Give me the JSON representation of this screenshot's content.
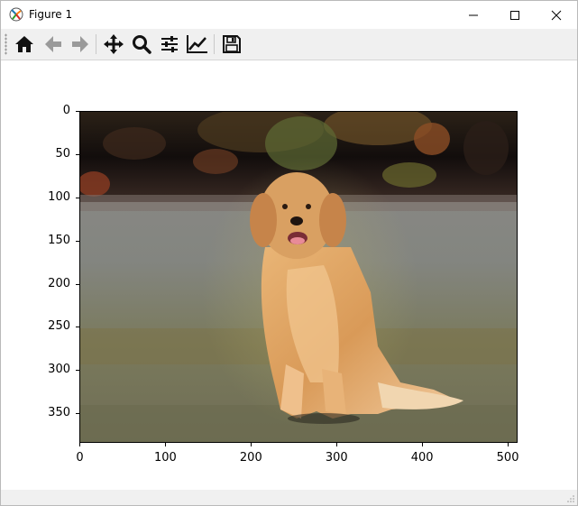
{
  "window": {
    "title": "Figure 1"
  },
  "toolbar": {
    "tools": [
      {
        "name": "home-icon",
        "tooltip": "Home"
      },
      {
        "name": "back-icon",
        "tooltip": "Back"
      },
      {
        "name": "forward-icon",
        "tooltip": "Forward"
      },
      {
        "name": "pan-icon",
        "tooltip": "Pan"
      },
      {
        "name": "zoom-icon",
        "tooltip": "Zoom"
      },
      {
        "name": "subplots-icon",
        "tooltip": "Subplots"
      },
      {
        "name": "customize-icon",
        "tooltip": "Customize"
      },
      {
        "name": "save-icon",
        "tooltip": "Save"
      }
    ]
  },
  "plot": {
    "y_ticks": [
      "0",
      "50",
      "100",
      "150",
      "200",
      "250",
      "300",
      "350"
    ],
    "x_ticks": [
      "0",
      "100",
      "200",
      "300",
      "400",
      "500"
    ],
    "image_description": "stylized golden retriever sitting, painting-like texture"
  },
  "colors": {
    "toolbar_bg": "#f0f0f0",
    "sky_dark": "#1b1410",
    "ground_gray": "#8a8b80",
    "dog_gold": "#e0a563"
  }
}
